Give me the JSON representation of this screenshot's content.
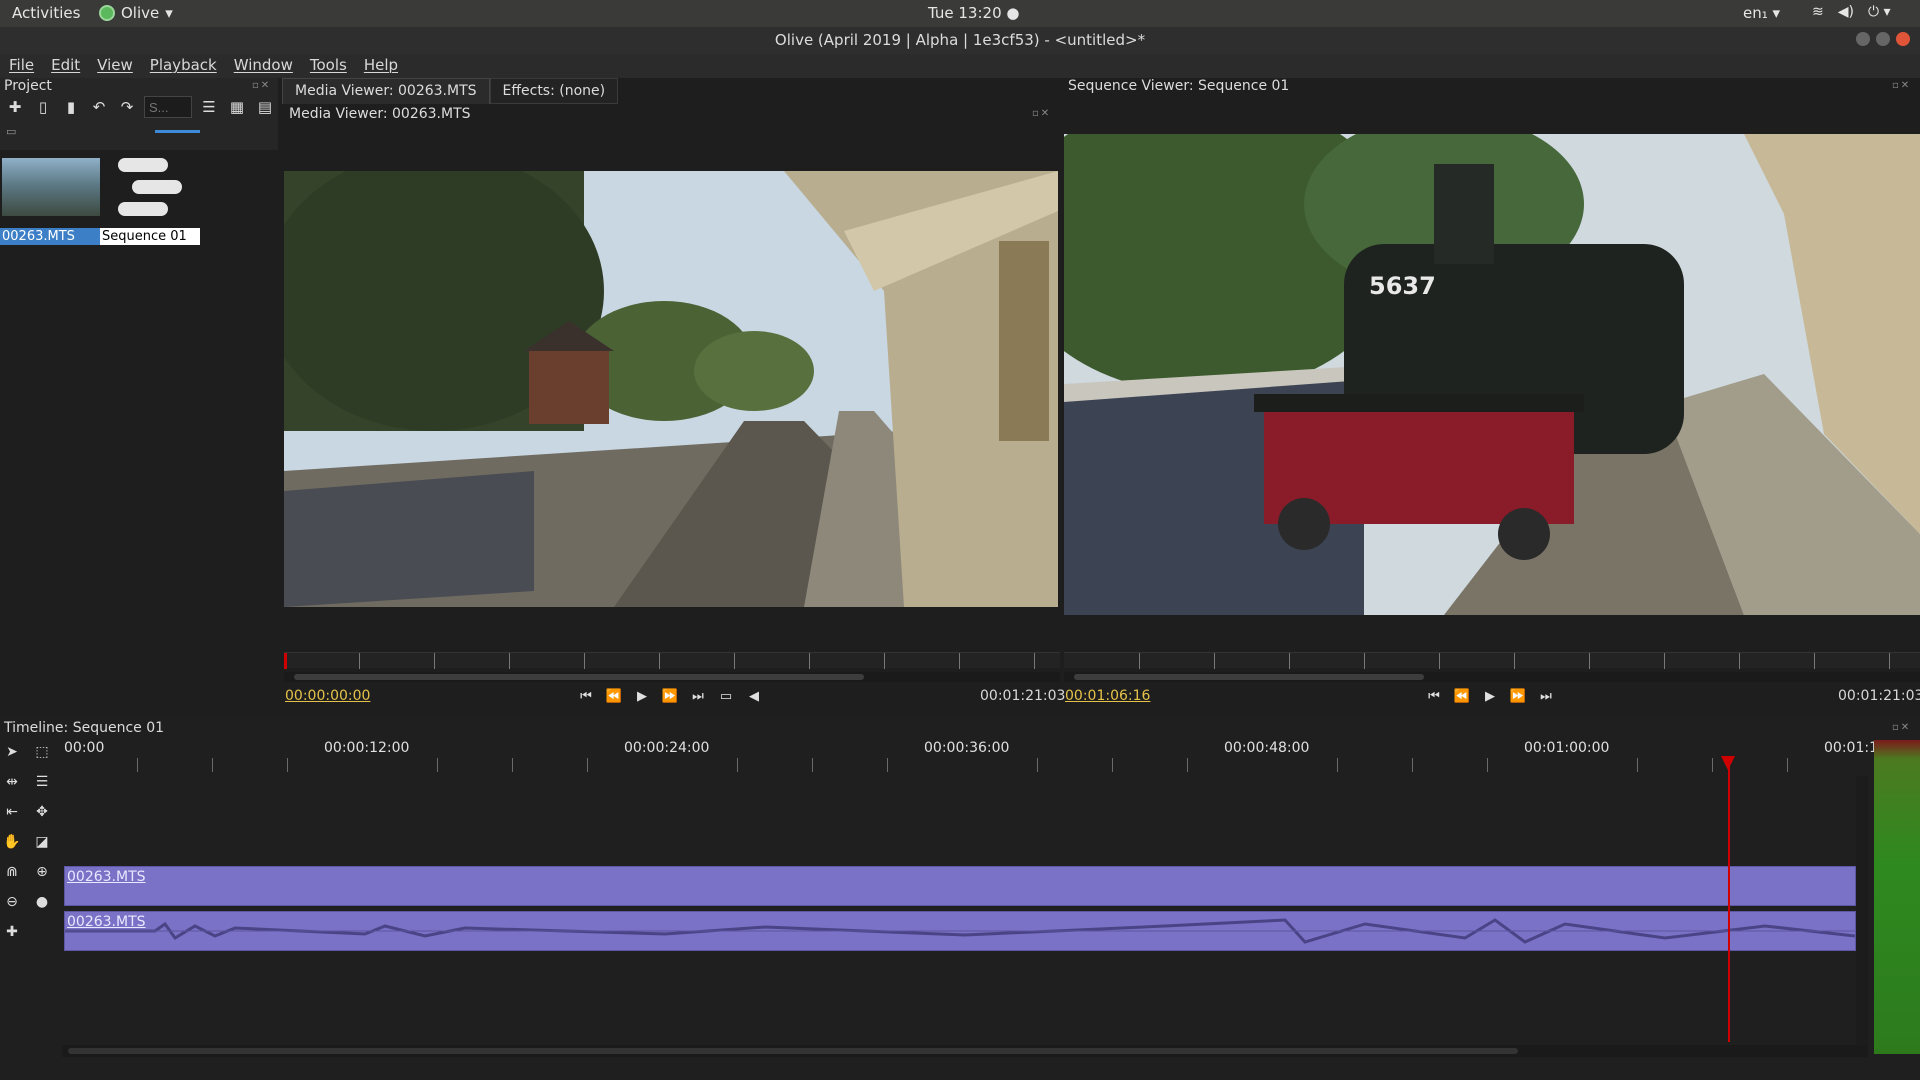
{
  "topbar": {
    "activities": "Activities",
    "app_name": "Olive",
    "clock": "Tue 13:20 ●",
    "lang": "en₁ ▾",
    "tray": [
      "wifi-icon",
      "volume-icon",
      "power-icon"
    ]
  },
  "window": {
    "title": "Olive (April 2019 | Alpha | 1e3cf53) - <untitled>*"
  },
  "menu": [
    "File",
    "Edit",
    "View",
    "Playback",
    "Window",
    "Tools",
    "Help"
  ],
  "project": {
    "title": "Project",
    "search_placeholder": "S...",
    "items": [
      {
        "label": "00263.MTS",
        "type": "media"
      },
      {
        "label": "Sequence 01",
        "type": "sequence"
      }
    ]
  },
  "media_viewer": {
    "tabs": [
      {
        "label": "Media Viewer: 00263.MTS",
        "active": true
      },
      {
        "label": "Effects: (none)",
        "active": false
      }
    ],
    "title": "Media Viewer: 00263.MTS",
    "current_tc": "00:00:00:00",
    "duration_tc": "00:01:21:03"
  },
  "sequence_viewer": {
    "title": "Sequence Viewer: Sequence 01",
    "current_tc": "00:01:06:16",
    "duration_tc": "00:01:21:03",
    "image_text": "5637"
  },
  "timeline": {
    "title": "Timeline: Sequence 01",
    "ruler_labels": [
      "00:00",
      "00:00:12:00",
      "00:00:24:00",
      "00:00:36:00",
      "00:00:48:00",
      "00:01:00:00",
      "00:01:1"
    ],
    "video_clip": "00263.MTS",
    "audio_clip": "00263.MTS",
    "clip_color": "#7a72c6",
    "playhead_color": "#d10000"
  }
}
